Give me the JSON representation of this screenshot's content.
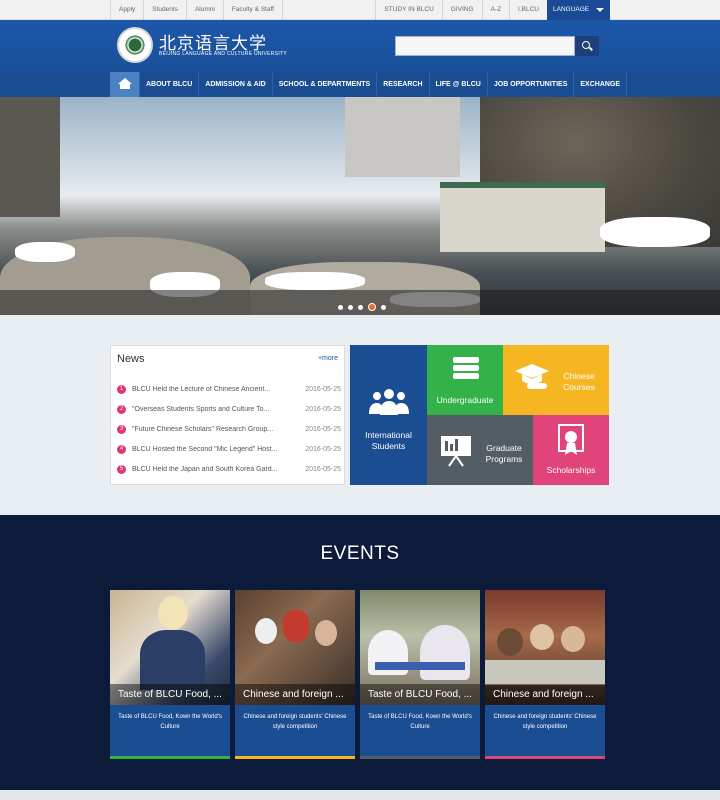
{
  "topbar": {
    "left_links": [
      "Apply",
      "Students",
      "Alumni",
      "Faculty & Staff"
    ],
    "right_links": [
      "STUDY IN BLCU",
      "GIVING",
      "A-Z",
      "I.BLCU"
    ],
    "language_label": "LANGUAGE"
  },
  "header": {
    "logo_cn": "北京语言大学",
    "logo_en": "BEIJING LANGUAGE AND CULTURE UNIVERSITY",
    "search_placeholder": ""
  },
  "nav": {
    "items": [
      "ABOUT BLCU",
      "ADMISSION & AID",
      "SCHOOL & DEPARTMENTS",
      "RESEARCH",
      "LIFE @ BLCU",
      "JOB OPPORTUNITIES",
      "EXCHANGE"
    ]
  },
  "hero": {
    "slides": 5,
    "active_slide": 4
  },
  "news": {
    "title": "News",
    "more": "+more",
    "items": [
      {
        "num": "1",
        "title": "BLCU Held the Lecture of Chinese Ancient...",
        "date": "2016-05-25"
      },
      {
        "num": "2",
        "title": "\"Overseas Students Sports and Culture To...",
        "date": "2016-05-25"
      },
      {
        "num": "3",
        "title": "\"Future Chinese Scholars\" Research Group...",
        "date": "2016-05-25"
      },
      {
        "num": "4",
        "title": "BLCU Hosted the Second \"Mic Legend\" Host...",
        "date": "2016-05-25"
      },
      {
        "num": "5",
        "title": "BLCU Held the Japan and South Korea Gard...",
        "date": "2016-05-25"
      }
    ]
  },
  "tiles": {
    "international": "International Students",
    "undergraduate": "Undergraduate",
    "chinese_courses": "Chinese Courses",
    "graduate": "Graduate Programs",
    "scholarships": "Scholarships"
  },
  "events": {
    "title": "EVENTS",
    "cards": [
      {
        "caption": "Taste of BLCU Food, ...",
        "desc": "Taste of BLCU Food, Kown the World's Culture",
        "bar": "#33b24a"
      },
      {
        "caption": "Chinese and foreign ...",
        "desc": "Chinese and foreign students' Chinese style competition",
        "bar": "#f5b621"
      },
      {
        "caption": "Taste of BLCU Food, ...",
        "desc": "Taste of BLCU Food, Kown the World's Culture",
        "bar": "#555d64"
      },
      {
        "caption": "Chinese and foreign ...",
        "desc": "Chinese and foreign students' Chinese style competition",
        "bar": "#e0447b"
      }
    ]
  },
  "colors": {
    "brand": "#1a55a6",
    "nav": "#1b4d93",
    "events_bg": "#0c1b3a"
  }
}
